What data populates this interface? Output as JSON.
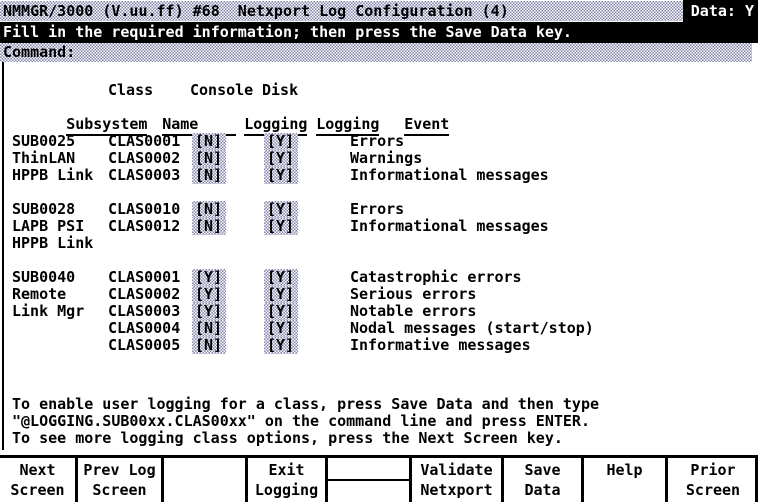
{
  "titlebar": {
    "title": "NMMGR/3000 (V.uu.ff) #68  Netxport Log Configuration (4)",
    "data_flag": "Data: Y"
  },
  "prompt": {
    "message": "Fill in the required information; then press the Save Data key."
  },
  "command": {
    "label": "Command:",
    "value": ""
  },
  "columns": {
    "subsystem": "Subsystem",
    "class_name_l1": "Class",
    "class_name_l2": "Name",
    "console_logging_l1": "Console",
    "console_logging_l2": "Logging",
    "disk_logging_l1": "Disk",
    "disk_logging_l2": "Logging",
    "event": "Event"
  },
  "groups": [
    {
      "subsystem_lines": [
        "SUB0025",
        "ThinLAN",
        "HPPB Link"
      ],
      "rows": [
        {
          "class_name": "CLAS0001",
          "console": "[N]",
          "disk": "[Y]",
          "event": "Errors"
        },
        {
          "class_name": "CLAS0002",
          "console": "[N]",
          "disk": "[Y]",
          "event": "Warnings"
        },
        {
          "class_name": "CLAS0003",
          "console": "[N]",
          "disk": "[Y]",
          "event": "Informational messages"
        }
      ]
    },
    {
      "subsystem_lines": [
        "SUB0028",
        "LAPB PSI",
        "HPPB Link"
      ],
      "rows": [
        {
          "class_name": "CLAS0010",
          "console": "[N]",
          "disk": "[Y]",
          "event": "Errors"
        },
        {
          "class_name": "CLAS0012",
          "console": "[N]",
          "disk": "[Y]",
          "event": "Informational messages"
        }
      ]
    },
    {
      "subsystem_lines": [
        "SUB0040",
        "Remote",
        "Link Mgr"
      ],
      "rows": [
        {
          "class_name": "CLAS0001",
          "console": "[Y]",
          "disk": "[Y]",
          "event": "Catastrophic errors"
        },
        {
          "class_name": "CLAS0002",
          "console": "[Y]",
          "disk": "[Y]",
          "event": "Serious errors"
        },
        {
          "class_name": "CLAS0003",
          "console": "[Y]",
          "disk": "[Y]",
          "event": "Notable errors"
        },
        {
          "class_name": "CLAS0004",
          "console": "[N]",
          "disk": "[Y]",
          "event": "Nodal messages (start/stop)"
        },
        {
          "class_name": "CLAS0005",
          "console": "[N]",
          "disk": "[Y]",
          "event": "Informative messages"
        }
      ]
    }
  ],
  "footnotes": [
    "To enable user logging for a class, press Save Data and then type",
    "\"@LOGGING.SUB00xx.CLAS00xx\" on the command line and press ENTER.",
    "To see more logging class options, press the Next Screen key."
  ],
  "function_keys": [
    {
      "line1": "Next",
      "line2": "Screen"
    },
    {
      "line1": "Prev Log",
      "line2": "Screen"
    },
    {
      "line1": "",
      "line2": ""
    },
    {
      "line1": "Exit",
      "line2": "Logging"
    },
    {
      "line1": "",
      "line2": ""
    },
    {
      "line1": "Validate",
      "line2": "Netxport"
    },
    {
      "line1": "Save",
      "line2": "Data"
    },
    {
      "line1": "Help",
      "line2": ""
    },
    {
      "line1": "Prior",
      "line2": "Screen"
    }
  ]
}
